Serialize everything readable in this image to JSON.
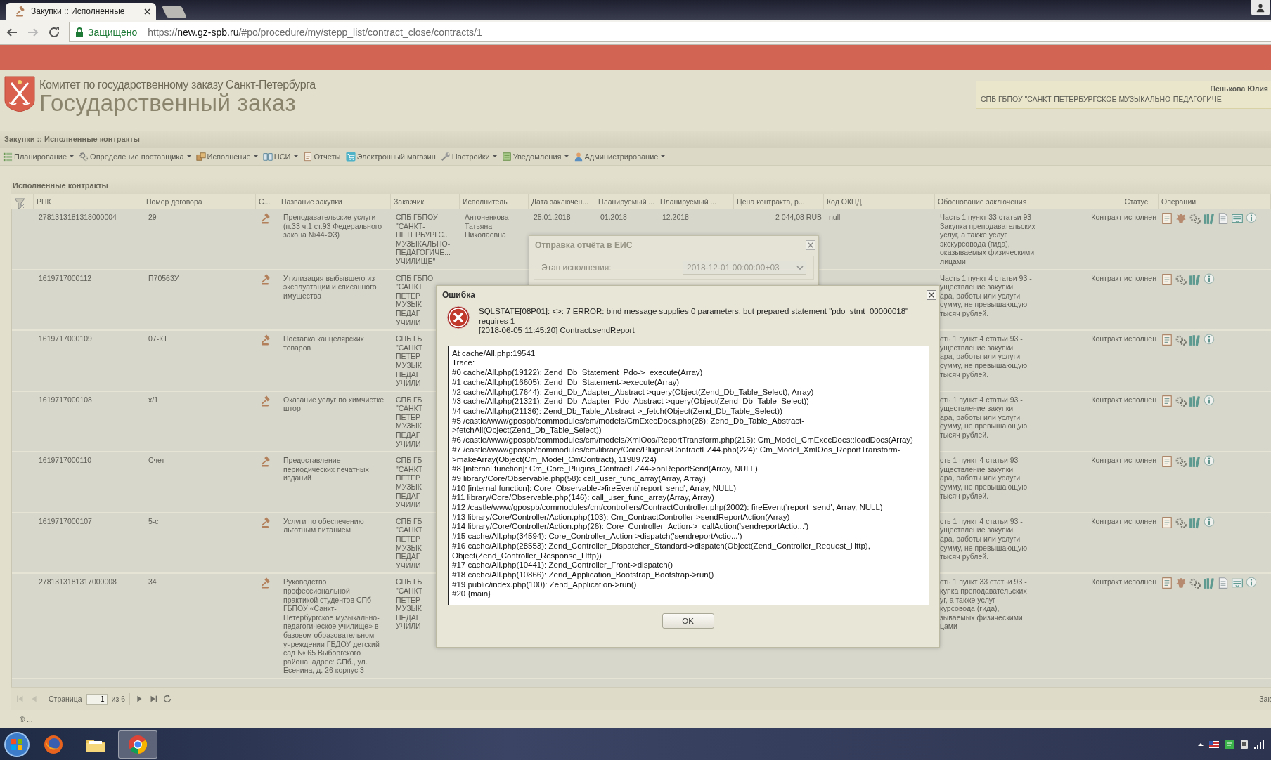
{
  "browser": {
    "tab": {
      "title": "Закупки :: Исполненные"
    },
    "back": {
      "disabled": false
    },
    "forward": {
      "disabled": true
    },
    "address": {
      "security_label": "Защищено",
      "url_scheme": "https://",
      "url_host": "new.gz-spb.ru",
      "url_path": "/#po/procedure/my/stepp_list/contract_close/contracts/1"
    }
  },
  "header": {
    "subtitle": "Комитет по государственному заказу Санкт-Петербурга",
    "title": "Государственный заказ",
    "user": {
      "name": "Пенькова Юлия",
      "organization": "СПБ ГБПОУ \"САНКТ-ПЕТЕРБУРГСКОЕ МУЗЫКАЛЬНО-ПЕДАГОГИЧЕ"
    }
  },
  "breadcrumb": "Закупки :: Исполненные контракты",
  "menu": [
    {
      "kind": "planning",
      "label": "Планирование",
      "has_submenu": true
    },
    {
      "kind": "supplier",
      "label": "Определение поставщика",
      "has_submenu": true
    },
    {
      "kind": "execution",
      "label": "Исполнение",
      "has_submenu": true
    },
    {
      "kind": "reference",
      "label": "НСИ",
      "has_submenu": true
    },
    {
      "kind": "reports",
      "label": "Отчеты",
      "has_submenu": false
    },
    {
      "kind": "shop",
      "label": "Электронный магазин",
      "has_submenu": false
    },
    {
      "kind": "settings",
      "label": "Настройки",
      "has_submenu": true
    },
    {
      "kind": "notifications",
      "label": "Уведомления",
      "has_submenu": true
    },
    {
      "kind": "admin",
      "label": "Администрирование",
      "has_submenu": true
    }
  ],
  "panel": {
    "title": "Исполненные контракты",
    "columns": [
      {
        "label": "РНК"
      },
      {
        "label": "Номер договора"
      },
      {
        "label": "С..."
      },
      {
        "label": "Название закупки"
      },
      {
        "label": "Заказчик"
      },
      {
        "label": "Исполнитель"
      },
      {
        "label": "Дата заключен..."
      },
      {
        "label": "Планируемый ..."
      },
      {
        "label": "Планируемый ..."
      },
      {
        "label": "Цена контракта, р..."
      },
      {
        "label": "Код ОКПД"
      },
      {
        "label": "Обоснование заключения"
      },
      {
        "label": "Статус"
      },
      {
        "label": "Операции"
      }
    ],
    "rows": [
      {
        "rnk": "2781313181318000004",
        "number": "29",
        "name": "Преподавательские услуги\n(п.33 ч.1 ст.93 Федерального\nзакона №44-ФЗ)",
        "customer": "СПБ ГБПОУ\n\"САНКТ-\nПЕТЕРБУРГС...\nМУЗЫКАЛЬНО-\nПЕДАГОГИЧЕ...\nУЧИЛИЩЕ\"",
        "executor": "Антоненкова\nТатьяна\nНиколаевна",
        "date": "25.01.2018",
        "plan_start": "01.2018",
        "plan_end": "12.2018",
        "price": "2 044,08 RUB",
        "okpd": "null",
        "basis": "Часть 1 пункт 33 статьи 93 -\nЗакупка преподавательских\nуслуг, а также услуг\nэкскурсовода (гида),\nоказываемых физическими\nлицами",
        "status": "Контракт исполнен",
        "operations": [
          {
            "kind": "report"
          },
          {
            "kind": "emblem"
          },
          {
            "kind": "gears"
          },
          {
            "kind": "books"
          },
          {
            "kind": "page"
          },
          {
            "kind": "tray"
          },
          {
            "kind": "info"
          }
        ]
      },
      {
        "rnk": "1619717000112",
        "number": "П70563У",
        "name": "Утилизация выбывшего из\nэксплуатации и списанного\nимущества",
        "customer": "СПБ ГБПО\n\"САНКТ\nПЕТЕР\nМУЗЫК\nПЕДАГ\nУЧИЛИ",
        "basis": "Часть 1 пункт 4 статьи 93 -\nуществление закупки\nара, работы или услуги\nсумму, не превышающую\nтысяч рублей.",
        "status": "Контракт исполнен",
        "operations": [
          {
            "kind": "report"
          },
          {
            "kind": "gears"
          },
          {
            "kind": "books"
          },
          {
            "kind": "info"
          }
        ]
      },
      {
        "rnk": "1619717000109",
        "number": "07-КТ",
        "name": "Поставка канцелярских\nтоваров",
        "customer": "СПБ ГБ\n\"САНКТ\nПЕТЕР\nМУЗЫК\nПЕДАГ\nУЧИЛИ",
        "basis": "сть 1 пункт 4 статьи 93 -\nуществление закупки\nара, работы или услуги\nсумму, не превышающую\nтысяч рублей.",
        "status": "Контракт исполнен",
        "operations": [
          {
            "kind": "report"
          },
          {
            "kind": "gears"
          },
          {
            "kind": "books"
          },
          {
            "kind": "info"
          }
        ]
      },
      {
        "rnk": "1619717000108",
        "number": "х/1",
        "name": "Оказание услуг по химчистке\nштор",
        "customer": "СПБ ГБ\n\"САНКТ\nПЕТЕР\nМУЗЫК\nПЕДАГ\nУЧИЛИ",
        "basis": "сть 1 пункт 4 статьи 93 -\nуществление закупки\nара, работы или услуги\nсумму, не превышающую\nтысяч рублей.",
        "status": "Контракт исполнен",
        "operations": [
          {
            "kind": "report"
          },
          {
            "kind": "gears"
          },
          {
            "kind": "books"
          },
          {
            "kind": "info"
          }
        ]
      },
      {
        "rnk": "1619717000110",
        "number": "Счет",
        "name": "Предоставление\nпериодических печатных\nизданий",
        "customer": "СПБ ГБ\n\"САНКТ\nПЕТЕР\nМУЗЫК\nПЕДАГ\nУЧИЛИ",
        "basis": "сть 1 пункт 4 статьи 93 -\nуществление закупки\nара, работы или услуги\nсумму, не превышающую\nтысяч рублей.",
        "status": "Контракт исполнен",
        "operations": [
          {
            "kind": "report"
          },
          {
            "kind": "gears"
          },
          {
            "kind": "books"
          },
          {
            "kind": "info"
          }
        ]
      },
      {
        "rnk": "1619717000107",
        "number": "5-с",
        "name": "Услуги по обеспечению\nльготным питанием",
        "customer": "СПБ ГБ\n\"САНКТ\nПЕТЕР\nМУЗЫК\nПЕДАГ\nУЧИЛИ",
        "basis": "сть 1 пункт 4 статьи 93 -\nуществление закупки\nара, работы или услуги\nсумму, не превышающую\nтысяч рублей.",
        "status": "Контракт исполнен",
        "operations": [
          {
            "kind": "report"
          },
          {
            "kind": "gears"
          },
          {
            "kind": "books"
          },
          {
            "kind": "info"
          }
        ]
      },
      {
        "rnk": "2781313181317000008",
        "number": "34",
        "name": "Руководство\nпрофессиональной\nпрактикой студентов СПб\nГБПОУ «Санкт-\nПетербургское музыкально-\nпедагогическое училище» в\nбазовом образовательном\nучреждении ГБДОУ детский\nсад № 65 Выборгского\nрайона, адрес: СПб., ул.\nЕсенина, д. 26 корпус 3",
        "customer": "СПБ ГБ\n\"САНКТ\nПЕТЕР\nМУЗЫК\nПЕДАГ\nУЧИЛИ",
        "basis": "сть 1 пункт 33 статьи 93 -\nкупка преподавательских\nуг, а также услуг\nкурсовода (гида),\nзываемых физическими\nцами",
        "status": "Контракт исполнен",
        "operations": [
          {
            "kind": "report"
          },
          {
            "kind": "emblem"
          },
          {
            "kind": "gears"
          },
          {
            "kind": "books"
          },
          {
            "kind": "page"
          },
          {
            "kind": "tray"
          },
          {
            "kind": "info"
          }
        ]
      }
    ],
    "pager": {
      "nav_before": [
        {
          "kind": "first",
          "disabled": true
        },
        {
          "kind": "prev",
          "disabled": true
        }
      ],
      "page_label": "Страница",
      "page": "1",
      "page_count": "из 6",
      "nav_after": [
        {
          "kind": "next",
          "disabled": false
        },
        {
          "kind": "last",
          "disabled": false
        },
        {
          "kind": "refresh",
          "disabled": false
        }
      ],
      "info": "Зак"
    }
  },
  "status_bar": "© ...",
  "report_dialog": {
    "title": "Отправка отчёта в ЕИС",
    "field_label": "Этап исполнения:",
    "field_value": "2018-12-01 00:00:00+03"
  },
  "error_dialog": {
    "title": "Ошибка",
    "message": "SQLSTATE[08P01]: <>: 7 ERROR: bind message supplies 0 parameters, but prepared statement \"pdo_stmt_00000018\"\nrequires 1\n[2018-06-05 11:45:20] Contract.sendReport",
    "trace_lines": [
      "At cache/All.php:19541",
      "Trace:",
      "#0 cache/All.php(19122): Zend_Db_Statement_Pdo->_execute(Array)",
      "#1 cache/All.php(16605): Zend_Db_Statement->execute(Array)",
      "#2 cache/All.php(17644): Zend_Db_Adapter_Abstract->query(Object(Zend_Db_Table_Select), Array)",
      "#3 cache/All.php(21321): Zend_Db_Adapter_Pdo_Abstract->query(Object(Zend_Db_Table_Select))",
      "#4 cache/All.php(21136): Zend_Db_Table_Abstract->_fetch(Object(Zend_Db_Table_Select))",
      "#5 /castle/www/gpospb/commodules/cm/models/CmExecDocs.php(28): Zend_Db_Table_Abstract-",
      ">fetchAll(Object(Zend_Db_Table_Select))",
      "#6 /castle/www/gpospb/commodules/cm/models/XmlOos/ReportTransform.php(215): Cm_Model_CmExecDocs::loadDocs(Array)",
      "#7 /castle/www/gpospb/commodules/cm/library/Core/Plugins/ContractFZ44.php(224): Cm_Model_XmlOos_ReportTransform-",
      ">makeArray(Object(Cm_Model_CmContract), 11989724)",
      "#8 [internal function]: Cm_Core_Plugins_ContractFZ44->onReportSend(Array, NULL)",
      "#9 library/Core/Observable.php(58): call_user_func_array(Array, Array)",
      "#10 [internal function]: Core_Observable->fireEvent('report_send', Array, NULL)",
      "#11 library/Core/Observable.php(146): call_user_func_array(Array, Array)",
      "#12 /castle/www/gpospb/commodules/cm/controllers/ContractController.php(2002): fireEvent('report_send', Array, NULL)",
      "#13 library/Core/Controller/Action.php(103): Cm_ContractController->sendReportAction(Array)",
      "#14 library/Core/Controller/Action.php(26): Core_Controller_Action->_callAction('sendreportActio...')",
      "#15 cache/All.php(34594): Core_Controller_Action->dispatch('sendreportActio...')",
      "#16 cache/All.php(28553): Zend_Controller_Dispatcher_Standard->dispatch(Object(Zend_Controller_Request_Http),",
      "Object(Zend_Controller_Response_Http))",
      "#17 cache/All.php(10441): Zend_Controller_Front->dispatch()",
      "#18 cache/All.php(10866): Zend_Application_Bootstrap_Bootstrap->run()",
      "#19 public/index.php(100): Zend_Application->run()",
      "#20 {main}"
    ],
    "ok_label": "OK"
  },
  "taskbar": {
    "apps": [
      {
        "kind": "firefox",
        "selected": false
      },
      {
        "kind": "folder",
        "selected": false
      },
      {
        "kind": "chrome",
        "selected": true
      }
    ]
  }
}
